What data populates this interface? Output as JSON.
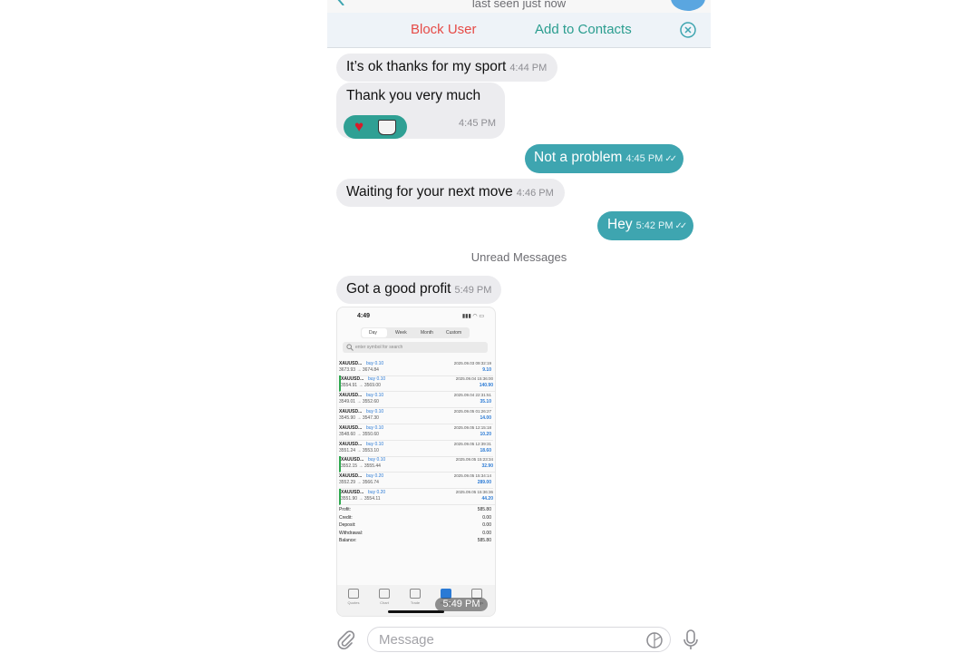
{
  "header": {
    "status": "last seen just now"
  },
  "actions": {
    "block": "Block User",
    "add": "Add to Contacts"
  },
  "messages": [
    {
      "text": "It’s ok thanks for my sport",
      "time": "4:44 PM"
    },
    {
      "text": "Thank you very much",
      "time": "4:45 PM"
    },
    {
      "text": "Not a problem",
      "time": "4:45 PM"
    },
    {
      "text": "Waiting for your next move",
      "time": "4:46 PM"
    },
    {
      "text": "Hey",
      "time": "5:42 PM"
    },
    {
      "text": "Got a good profit",
      "time": "5:49 PM"
    }
  ],
  "sticker": {
    "items": [
      "heart-emoji",
      "coffee-emoji"
    ]
  },
  "divider": "Unread Messages",
  "screenshot": {
    "time": "4:49",
    "tabs": [
      "Day",
      "Week",
      "Month",
      "Custom"
    ],
    "search_placeholder": "enter symbol for search",
    "rows": [
      {
        "sym": "XAUUSD...",
        "side": "buy 0.10",
        "px": "3673.93 → 3674.84",
        "dt": "2025.09.03 09:32:19",
        "pl": "9.10"
      },
      {
        "sym": "XAUUSD...",
        "side": "buy 0.10",
        "px": "3554.91 → 3569.00",
        "dt": "2025.09.04 15:36:00",
        "pl": "140.90"
      },
      {
        "sym": "XAUUSD...",
        "side": "buy 0.10",
        "px": "3549.01 → 3552.60",
        "dt": "2025.09.04 22:31:51",
        "pl": "35.10"
      },
      {
        "sym": "XAUUSD...",
        "side": "buy 0.10",
        "px": "3545.90 → 3547.30",
        "dt": "2025.09.05 01:26:27",
        "pl": "14.00"
      },
      {
        "sym": "XAUUSD...",
        "side": "buy 0.10",
        "px": "3548.60 → 3550.60",
        "dt": "2025.09.05 12:15:18",
        "pl": "10.20"
      },
      {
        "sym": "XAUUSD...",
        "side": "buy 0.10",
        "px": "3551.24 → 3553.10",
        "dt": "2025.09.05 12:39:31",
        "pl": "18.60"
      },
      {
        "sym": "XAUUSD...",
        "side": "buy 0.10",
        "px": "3552.15 → 3555.44",
        "dt": "2025.09.05 15:23:34",
        "pl": "32.90"
      },
      {
        "sym": "XAUUSD...",
        "side": "buy 0.20",
        "px": "3552.29 → 3566.74",
        "dt": "2025.09.05 15:34:14",
        "pl": "289.00"
      },
      {
        "sym": "XAUUSD...",
        "side": "buy 0.20",
        "px": "3551.90 → 3554.11",
        "dt": "2025.09.05 15:36:36",
        "pl": "44.20"
      }
    ],
    "summary": [
      {
        "k": "Profit:",
        "v": "585.80"
      },
      {
        "k": "Credit:",
        "v": "0.00"
      },
      {
        "k": "Deposit:",
        "v": "0.00"
      },
      {
        "k": "Withdrawal:",
        "v": "0.00"
      },
      {
        "k": "Balance:",
        "v": "585.80"
      }
    ],
    "tabbar": [
      "Quotes",
      "Chart",
      "Trade",
      "History",
      "Settings"
    ],
    "stamp": "5:49 PM"
  },
  "composer": {
    "placeholder": "Message"
  },
  "colors": {
    "outgoing": "#3ea5b0",
    "incoming": "#ececef",
    "danger": "#e64b47",
    "accent": "#2a9d8f"
  }
}
